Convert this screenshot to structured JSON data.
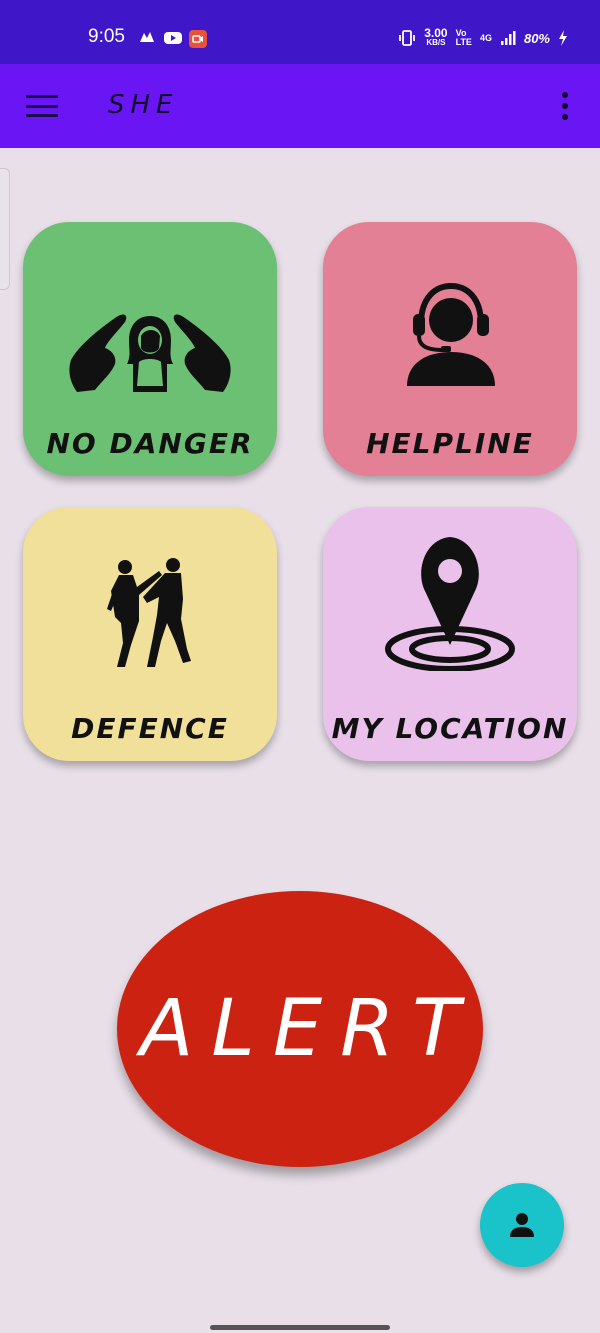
{
  "status_bar": {
    "time": "9:05",
    "net_speed_value": "3.00",
    "net_speed_unit": "KB/S",
    "volte_top": "Vo",
    "volte_bottom": "LTE",
    "network": "4G",
    "battery": "80%"
  },
  "app_bar": {
    "title": "SHE"
  },
  "tiles": [
    {
      "label": "NO DANGER",
      "color": "#6cc074",
      "icon": "protected-woman-icon"
    },
    {
      "label": "HELPLINE",
      "color": "#e48096",
      "icon": "headset-agent-icon"
    },
    {
      "label": "DEFENCE",
      "color": "#f0e099",
      "icon": "self-defence-icon"
    },
    {
      "label": "MY LOCATION",
      "color": "#e9c1eb",
      "icon": "location-pin-icon"
    }
  ],
  "alert": {
    "label": "ALERT",
    "color": "#cc2212"
  },
  "fab": {
    "icon": "person-icon",
    "color": "#19c3c9"
  },
  "colors": {
    "status_bar": "#3f16c8",
    "app_bar": "#6a16f4",
    "background": "#e8dfe8"
  }
}
